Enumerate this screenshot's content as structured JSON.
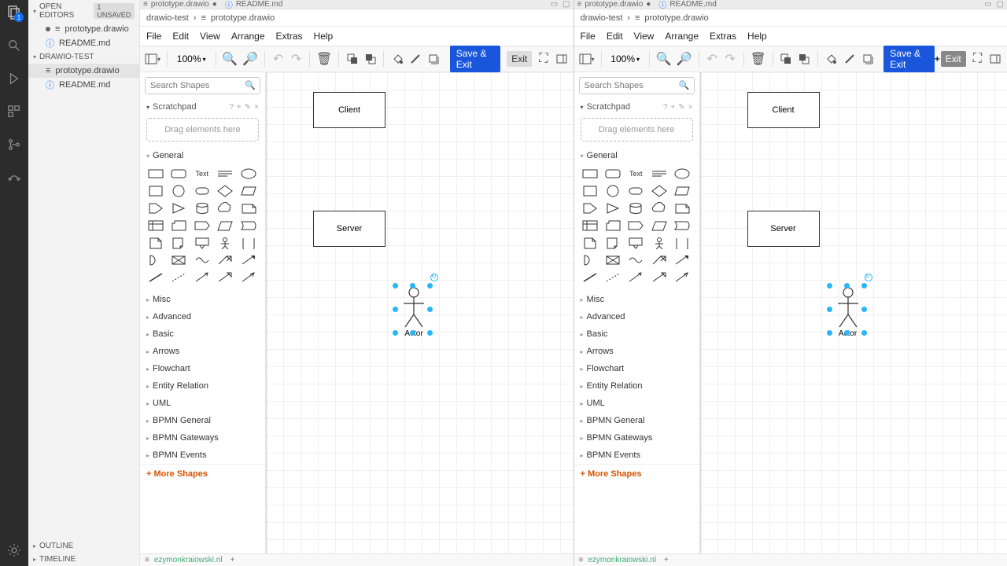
{
  "activity_badge": "1",
  "sidebar": {
    "open_editors": "OPEN EDITORS",
    "unsaved_tag": "1 UNSAVED",
    "file1": "prototype.drawio",
    "file2": "README.md",
    "project": "DRAWIO-TEST",
    "pf1": "prototype.drawio",
    "pf2": "README.md",
    "outline": "OUTLINE",
    "timeline": "TIMELINE"
  },
  "tabs": {
    "t1": "prototype.drawio",
    "t2": "README.md"
  },
  "breadcrumb": {
    "b1": "drawio-test",
    "sep": "›",
    "b2": "prototype.drawio"
  },
  "menu": {
    "file": "File",
    "edit": "Edit",
    "view": "View",
    "arrange": "Arrange",
    "extras": "Extras",
    "help": "Help"
  },
  "toolbar": {
    "zoom": "100%",
    "save": "Save & Exit",
    "exit": "Exit"
  },
  "shapes": {
    "search_ph": "Search Shapes",
    "scratch": "Scratchpad",
    "drop": "Drag elements here",
    "general": "General",
    "text": "Text",
    "cats": [
      "Misc",
      "Advanced",
      "Basic",
      "Arrows",
      "Flowchart",
      "Entity Relation",
      "UML",
      "BPMN General",
      "BPMN Gateways",
      "BPMN Events"
    ],
    "more": "+ More Shapes"
  },
  "diagram": {
    "client": "Client",
    "server": "Server",
    "actor": "Actor"
  },
  "status": {
    "user": "ezymonkraiowski.nl"
  }
}
